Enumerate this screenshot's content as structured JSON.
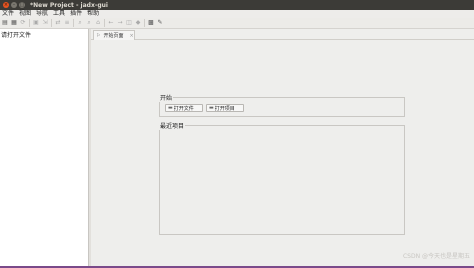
{
  "window": {
    "title": "*New Project - jadx-gui",
    "controls": [
      "×",
      "–",
      "□"
    ]
  },
  "menu": [
    "文件",
    "视图",
    "导航",
    "工具",
    "插件",
    "帮助"
  ],
  "toolbar": {
    "icons": [
      {
        "name": "open-folder-icon",
        "glyph": "▤",
        "enabled": true
      },
      {
        "name": "add-files-icon",
        "glyph": "▦",
        "enabled": true
      },
      {
        "name": "reload-icon",
        "glyph": "⟳",
        "enabled": false
      },
      {
        "name": "save-icon",
        "glyph": "▣",
        "enabled": false
      },
      {
        "name": "export-icon",
        "glyph": "⇲",
        "enabled": false
      },
      {
        "name": "sync-tree-icon",
        "glyph": "⇄",
        "enabled": false
      },
      {
        "name": "flat-packages-icon",
        "glyph": "≡",
        "enabled": false
      },
      {
        "name": "search-icon",
        "glyph": "⌕",
        "enabled": false
      },
      {
        "name": "find-class-icon",
        "glyph": "⌕",
        "enabled": false
      },
      {
        "name": "home-icon",
        "glyph": "⌂",
        "enabled": false
      },
      {
        "name": "back-icon",
        "glyph": "←",
        "enabled": false
      },
      {
        "name": "forward-icon",
        "glyph": "→",
        "enabled": false
      },
      {
        "name": "quark-icon",
        "glyph": "◫",
        "enabled": false
      },
      {
        "name": "deobfuscation-icon",
        "glyph": "◆",
        "enabled": false
      },
      {
        "name": "log-icon",
        "glyph": "▩",
        "enabled": true
      },
      {
        "name": "preferences-icon",
        "glyph": "✎",
        "enabled": true
      }
    ]
  },
  "tree": {
    "placeholder": "请打开文件"
  },
  "tabs": [
    {
      "label": "开始页面",
      "close": "×"
    }
  ],
  "start_page": {
    "start_title": "开始",
    "open_file_label": "打开文件",
    "open_project_label": "打开项目",
    "recent_title": "最近项目"
  },
  "watermark": "CSDN @今天也是星期五"
}
